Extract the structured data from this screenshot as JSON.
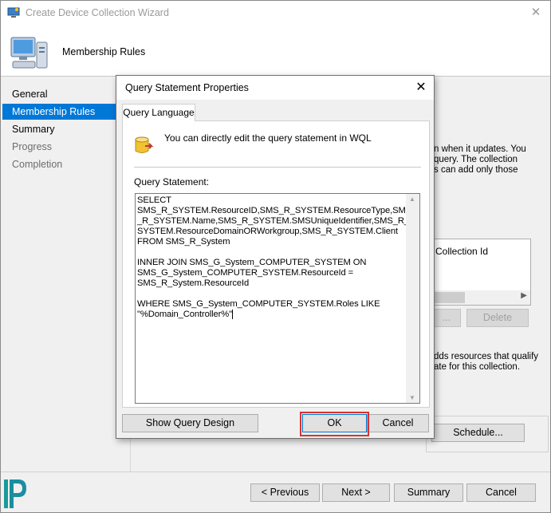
{
  "window": {
    "title": "Create Device Collection Wizard",
    "close_glyph": "✕",
    "heading": "Membership Rules"
  },
  "nav": {
    "items": [
      {
        "label": "General",
        "state": "normal"
      },
      {
        "label": "Membership Rules",
        "state": "active"
      },
      {
        "label": "Summary",
        "state": "normal"
      },
      {
        "label": "Progress",
        "state": "disabled"
      },
      {
        "label": "Completion",
        "state": "disabled"
      }
    ]
  },
  "content": {
    "description_lines": [
      "n when it updates. You",
      "query. The collection",
      "s can add only those"
    ],
    "column_header": "Collection Id",
    "edit_label": "...",
    "delete_label": "Delete",
    "description2_lines": [
      "dds resources that qualify",
      "ate for this collection."
    ],
    "schedule_label": "Schedule..."
  },
  "footer": {
    "previous_label": "< Previous",
    "next_label": "Next >",
    "summary_label": "Summary",
    "cancel_label": "Cancel"
  },
  "dialog": {
    "title": "Query Statement Properties",
    "close_glyph": "✕",
    "tab_label": "Query Language",
    "hint": "You can directly edit the query statement in WQL",
    "query_label": "Query Statement:",
    "query_lines": [
      "SELECT",
      "SMS_R_SYSTEM.ResourceID,SMS_R_SYSTEM.ResourceType,SMS",
      "_R_SYSTEM.Name,SMS_R_SYSTEM.SMSUniqueIdentifier,SMS_R_",
      "SYSTEM.ResourceDomainORWorkgroup,SMS_R_SYSTEM.Client",
      "FROM SMS_R_System",
      "",
      "INNER JOIN SMS_G_System_COMPUTER_SYSTEM ON",
      "SMS_G_System_COMPUTER_SYSTEM.ResourceId =",
      "SMS_R_System.ResourceId",
      "",
      "WHERE SMS_G_System_COMPUTER_SYSTEM.Roles LIKE",
      "\"%Domain_Controller%\""
    ],
    "show_design_label": "Show Query Design",
    "ok_label": "OK",
    "cancel_label": "Cancel"
  },
  "colors": {
    "accent": "#0078d7",
    "highlight": "#d9322e"
  }
}
